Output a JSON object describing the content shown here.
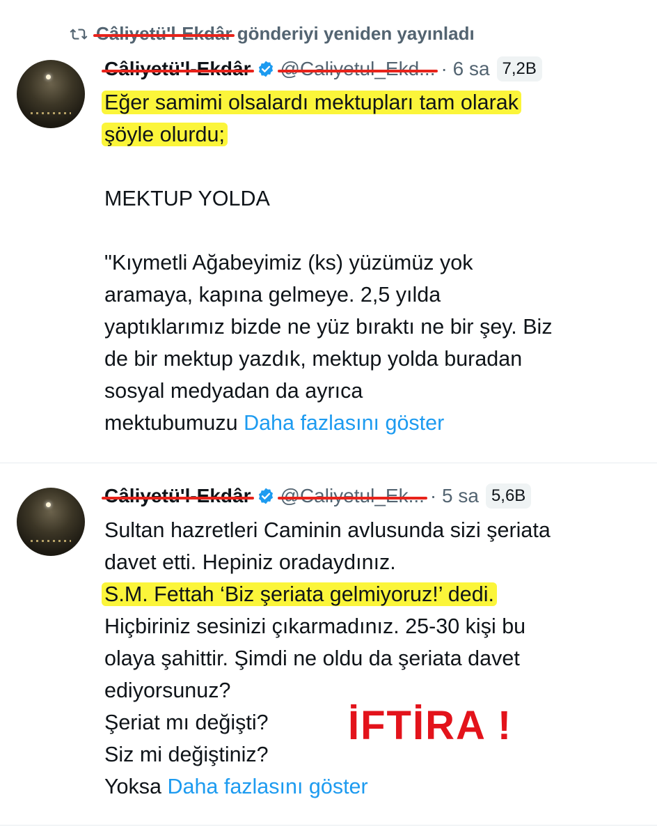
{
  "repost": {
    "reposter_name": "Câliyetü'l-Ekdâr",
    "action_text": "gönderiyi yeniden yayınladı"
  },
  "tweets": [
    {
      "name": "Câliyetü'l-Ekdâr",
      "handle": "@Caliyetul_Ekd...",
      "time": "· 6 sa",
      "views": "7,2B",
      "lines": [
        "Eğer samimi olsalardı mektupları tam olarak",
        "şöyle olurdu;",
        "",
        "MEKTUP YOLDA",
        "",
        "\"Kıymetli Ağabeyimiz (ks) yüzümüz yok",
        "aramaya, kapına gelmeye. 2,5 yılda",
        "yaptıklarımız bizde ne yüz bıraktı ne bir şey. Biz",
        "de bir mektup yazdık, mektup yolda buradan",
        "sosyal medyadan da ayrıca",
        "mektubumuzu"
      ],
      "more": "Daha fazlasını göster"
    },
    {
      "name": "Câliyetü'l-Ekdâr",
      "handle": "@Caliyetul_Ek...",
      "time": "· 5 sa",
      "views": "5,6B",
      "lines": [
        "Sultan hazretleri Caminin avlusunda sizi şeriata",
        "davet etti. Hepiniz oradaydınız.",
        "S.M. Fettah ‘Biz şeriata gelmiyoruz!’ dedi.",
        "Hiçbiriniz sesinizi çıkarmadınız. 25-30 kişi bu",
        "olaya şahittir. Şimdi ne oldu da şeriata davet",
        "ediyorsunuz?",
        "Şeriat mı değişti?",
        "Siz mi değiştiniz?",
        "Yoksa"
      ],
      "more": "Daha fazlasını göster"
    }
  ],
  "annotation": {
    "stamp_text": "İFTİRA !",
    "strike_color": "#e8231b",
    "highlight_color": "#fbf53a",
    "stamp_color": "#e3131b"
  },
  "icons": {
    "repost": "repost-icon",
    "verified": "verified-badge-icon"
  },
  "colors": {
    "link": "#1d9bf0",
    "muted": "#536471",
    "verified": "#1d9bf0"
  }
}
